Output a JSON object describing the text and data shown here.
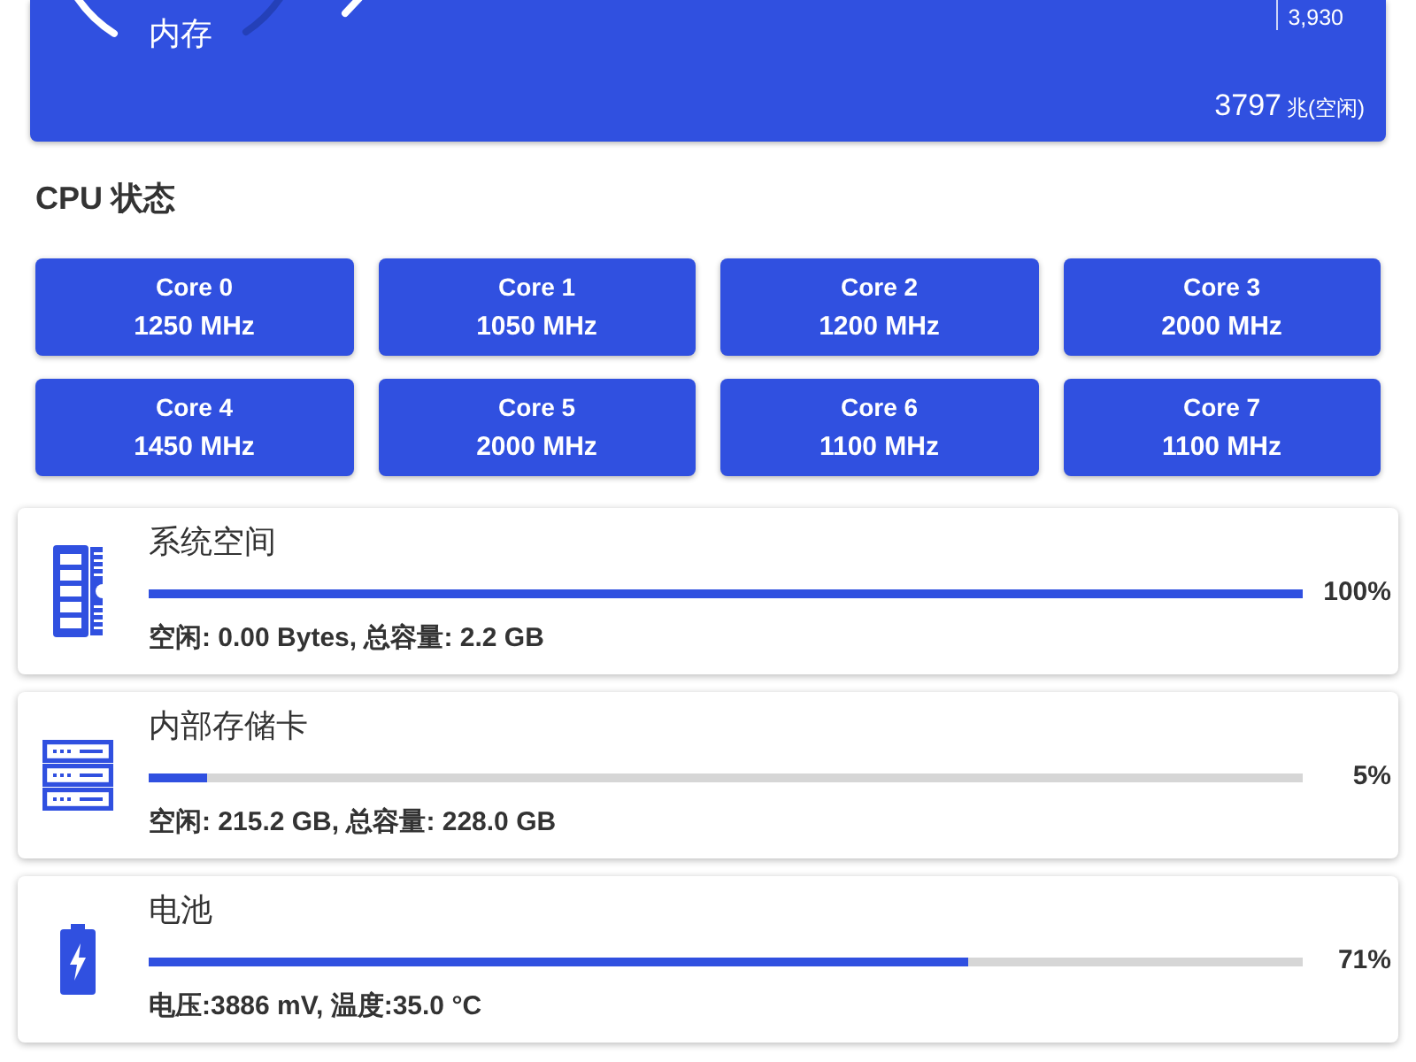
{
  "memory_panel": {
    "label": "内存",
    "side_reading": "3,930",
    "free_value": "3797",
    "free_unit": "兆(空闲)"
  },
  "cpu": {
    "title": "CPU 状态",
    "cores": [
      {
        "name": "Core 0",
        "frequency": "1250 MHz"
      },
      {
        "name": "Core 1",
        "frequency": "1050 MHz"
      },
      {
        "name": "Core 2",
        "frequency": "1200 MHz"
      },
      {
        "name": "Core 3",
        "frequency": "2000 MHz"
      },
      {
        "name": "Core 4",
        "frequency": "1450 MHz"
      },
      {
        "name": "Core 5",
        "frequency": "2000 MHz"
      },
      {
        "name": "Core 6",
        "frequency": "1100 MHz"
      },
      {
        "name": "Core 7",
        "frequency": "1100 MHz"
      }
    ]
  },
  "status_cards": [
    {
      "kind": "memory",
      "title": "系统空间",
      "level": 1.0,
      "percent": "100%",
      "detail": "空闲: 0.00 Bytes, 总容量: 2.2 GB"
    },
    {
      "kind": "storage",
      "title": "内部存储卡",
      "level": 0.05,
      "percent": "5%",
      "detail": "空闲: 215.2 GB, 总容量: 228.0 GB"
    },
    {
      "kind": "battery",
      "title": "电池",
      "level": 0.71,
      "percent": "71%",
      "detail": "电压:3886 mV, 温度:35.0 °C"
    }
  ]
}
